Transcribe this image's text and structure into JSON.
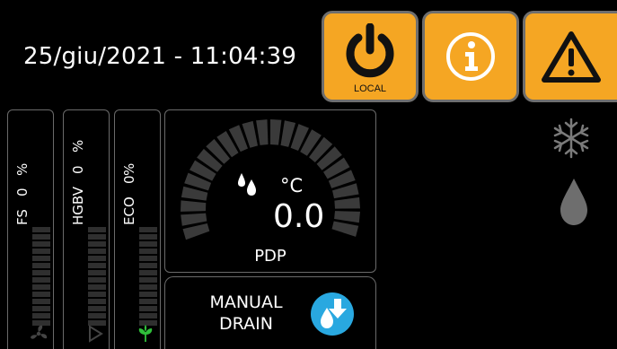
{
  "header": {
    "datetime": "25/giu/2021 - 11:04:39"
  },
  "buttons": {
    "power": {
      "icon": "power-icon",
      "label": "LOCAL"
    },
    "info": {
      "icon": "info-icon"
    },
    "warning": {
      "icon": "warning-icon"
    }
  },
  "bars": [
    {
      "label": "FS",
      "value": "0",
      "unit": "%",
      "icon": "fan-icon",
      "icon_color": "#444444",
      "level": 0
    },
    {
      "label": "HGBV",
      "value": "0",
      "unit": "%",
      "icon": "play-icon",
      "icon_color": "#444444",
      "level": 0
    },
    {
      "label": "ECO",
      "value": "0",
      "unit": "%",
      "icon": "leaf-icon",
      "icon_color": "#2fbf3a",
      "level": 0
    }
  ],
  "gauge": {
    "unit": "°C",
    "value": "0.0",
    "label": "PDP",
    "icon": "water-drops-icon"
  },
  "manual_drain": {
    "line1": "MANUAL",
    "line2": "DRAIN",
    "icon": "drain-icon",
    "icon_color": "#29a8e0"
  },
  "status_icons": {
    "cooling": "snowflake-icon",
    "water": "water-drop-icon"
  },
  "colors": {
    "accent": "#f5a623",
    "panel_border": "#6a6a6a",
    "inactive_segment": "#2f2f2f"
  }
}
